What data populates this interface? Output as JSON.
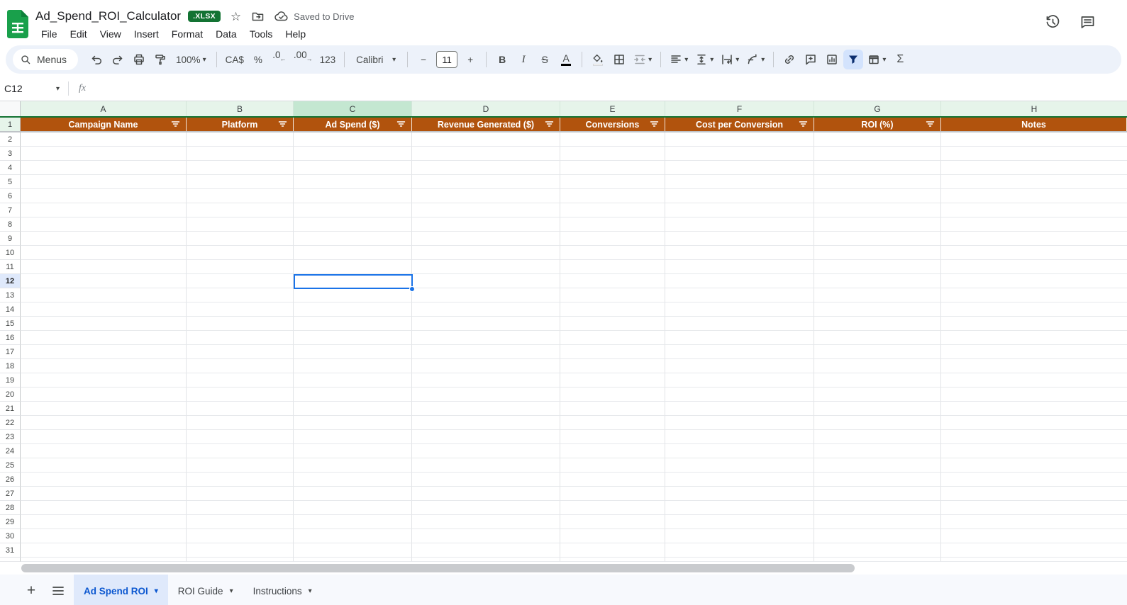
{
  "header": {
    "title": "Ad_Spend_ROI_Calculator",
    "file_type_badge": ".XLSX",
    "saved_status": "Saved to Drive",
    "menu_items": [
      "File",
      "Edit",
      "View",
      "Insert",
      "Format",
      "Data",
      "Tools",
      "Help"
    ]
  },
  "toolbar": {
    "menus_label": "Menus",
    "zoom_value": "100%",
    "currency_label": "CA$",
    "percent_label": "%",
    "decrease_decimal_label": ".0",
    "increase_decimal_label": ".00",
    "number_format_label": "123",
    "font_name": "Calibri",
    "font_size": "11",
    "minus_label": "−",
    "plus_label": "+",
    "bold_label": "B",
    "italic_label": "I",
    "strikethrough_label": "S",
    "text_color_label": "A",
    "functions_label": "Σ"
  },
  "formula_bar": {
    "cell_reference": "C12",
    "fx_label": "fx"
  },
  "grid": {
    "column_letters": [
      "A",
      "B",
      "C",
      "D",
      "E",
      "F",
      "G",
      "H"
    ],
    "selected_column": "C",
    "selected_cell": "C12",
    "selected_row": 12,
    "first_row": 2,
    "last_row": 31,
    "header_row_number": "1",
    "headers": [
      "Campaign Name",
      "Platform",
      "Ad Spend ($)",
      "Revenue Generated ($)",
      "Conversions",
      "Cost per Conversion",
      "ROI (%)",
      "Notes"
    ]
  },
  "sheet_tabs": {
    "tabs": [
      {
        "label": "Ad Spend ROI",
        "active": true
      },
      {
        "label": "ROI Guide",
        "active": false
      },
      {
        "label": "Instructions",
        "active": false
      }
    ]
  },
  "colors": {
    "header_row_fill": "#b1530d",
    "header_row_text": "#ffffff",
    "column_header_green": "#e6f4ea",
    "selected_column_green": "#c4e7d1",
    "green_divider": "#137333",
    "selection_blue": "#1a73e8",
    "active_tab_blue": "#0b57d0",
    "filter_active_bg": "#d3e3fd",
    "logo_green": "#19a04b",
    "badge_green": "#137333"
  }
}
